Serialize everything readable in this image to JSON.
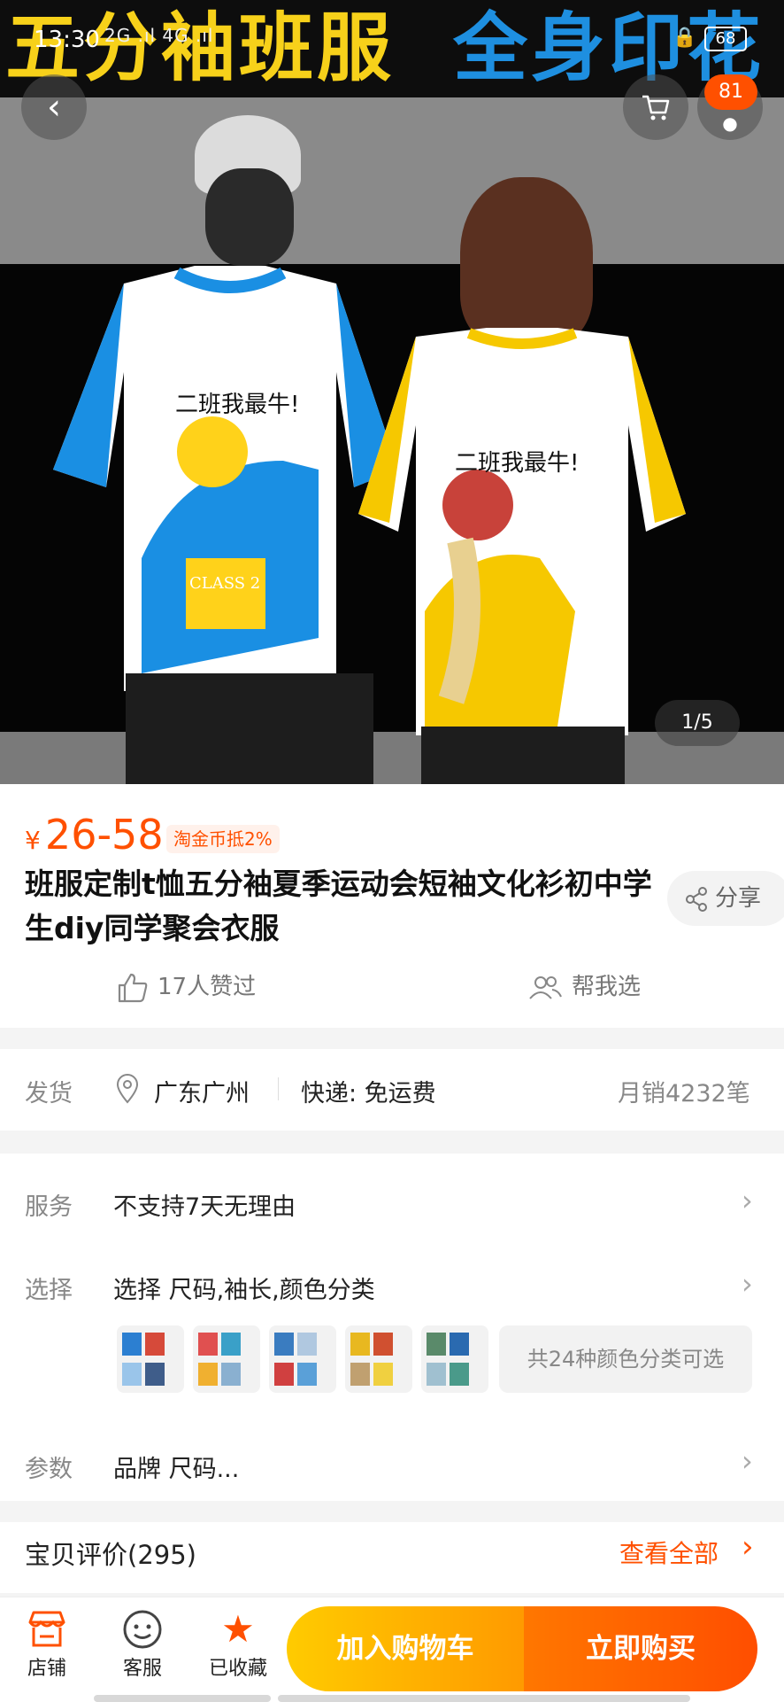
{
  "status_bar": {
    "time": "13:30",
    "signal": "2G .ıl 4G .ıl",
    "battery": "68"
  },
  "banner": {
    "left_text": "五分袖班服",
    "right_text": "全身印花"
  },
  "nav": {
    "back_icon": "chevron-left-icon",
    "cart_icon": "cart-icon",
    "more_badge": "81"
  },
  "gallery": {
    "pager": "1/5",
    "shirt_text_left": "二班我最牛!",
    "shirt_text_right": "二班我最牛!",
    "class_label": "CLASS 2"
  },
  "product": {
    "currency": "¥",
    "price": "26-58",
    "coin_tag": "淘金币抵2%",
    "title": "班服定制t恤五分袖夏季运动会短袖文化衫初中学生diy同学聚会衣服",
    "share_label": "分享",
    "likes": "17人赞过",
    "help_choose": "帮我选"
  },
  "shipping": {
    "label": "发货",
    "location": "广东广州",
    "delivery": "快递: 免运费",
    "monthly_sales": "月销4232笔"
  },
  "options": {
    "service_label": "服务",
    "service_text": "不支持7天无理由",
    "select_label": "选择",
    "select_text": "选择 尺码,袖长,颜色分类",
    "color_count": "共24种颜色分类可选",
    "params_label": "参数",
    "params_text": "品牌 尺码..."
  },
  "reviews": {
    "title": "宝贝评价(295)",
    "view_all": "查看全部"
  },
  "bottom_bar": {
    "shop": "店铺",
    "service": "客服",
    "favorited": "已收藏",
    "add_cart": "加入购物车",
    "buy_now": "立即购买"
  },
  "colors": {
    "accent": "#ff5000",
    "cart_button": "#ffb800",
    "buy_button": "#ff5a00"
  }
}
